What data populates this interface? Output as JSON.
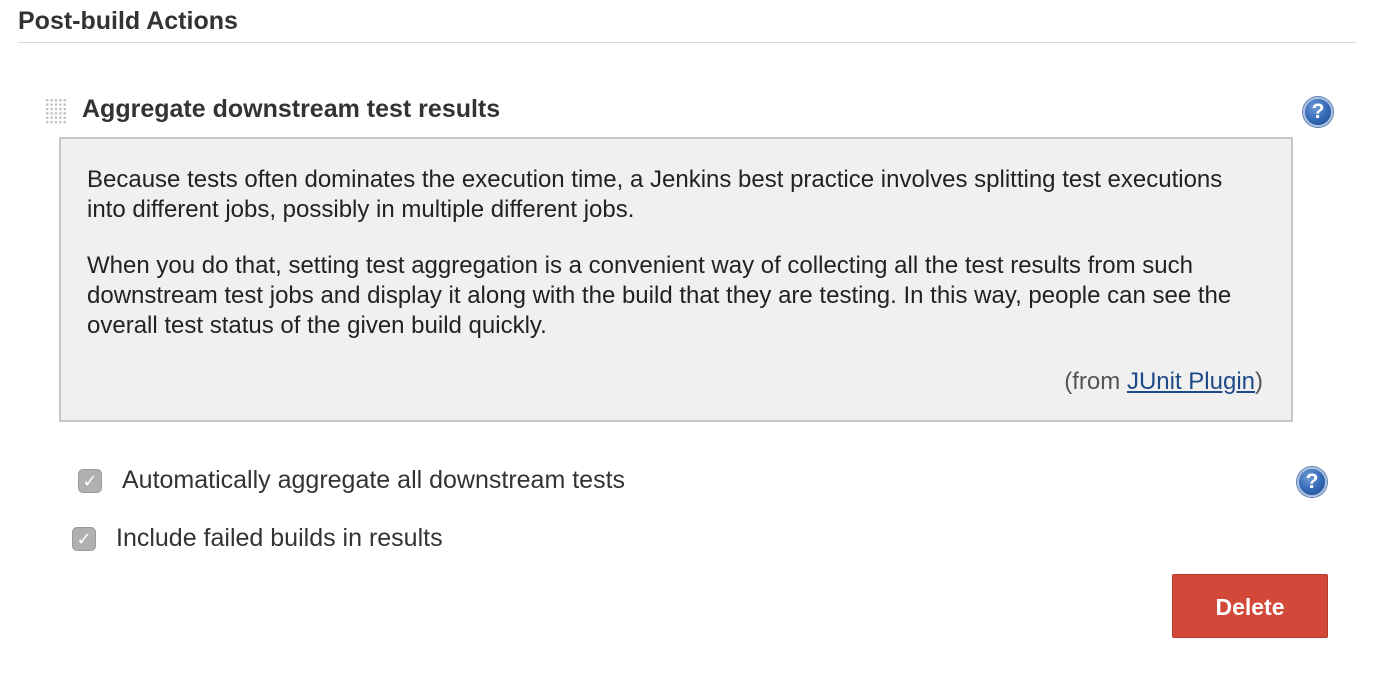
{
  "section": {
    "title": "Post-build Actions"
  },
  "step": {
    "title": "Aggregate downstream test results",
    "help_icon": "question-mark-icon",
    "help": {
      "paragraph_1": "Because tests often dominates the execution time, a Jenkins best practice involves splitting test executions into different jobs, possibly in multiple different jobs.",
      "paragraph_2": "When you do that, setting test aggregation is a convenient way of collecting all the test results from such downstream test jobs and display it along with the build that they are testing. In this way, people can see the overall test status of the given build quickly.",
      "from_prefix": "(from ",
      "from_link": "JUnit Plugin",
      "from_suffix": ")"
    }
  },
  "options": [
    {
      "label": "Automatically aggregate all downstream tests",
      "checked": true,
      "has_help": true
    },
    {
      "label": "Include failed builds in results",
      "checked": true,
      "has_help": false
    }
  ],
  "actions": {
    "delete_label": "Delete"
  },
  "colors": {
    "delete_button": "#d24939",
    "help_icon": "#3267b4",
    "help_box_background": "#f0f0f0",
    "link": "#204a87"
  }
}
